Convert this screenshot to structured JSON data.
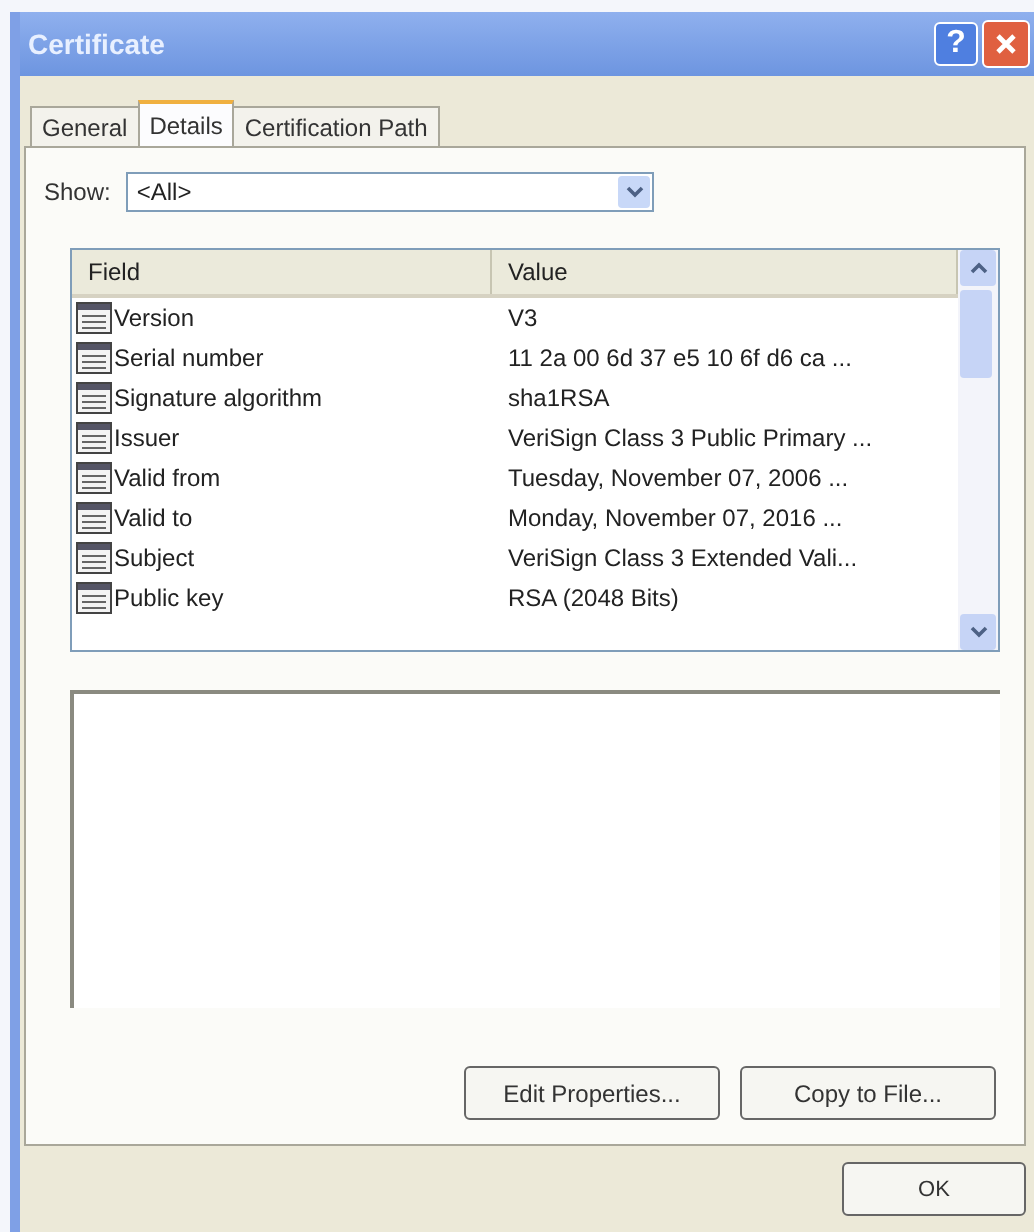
{
  "window": {
    "title": "Certificate",
    "help": "?"
  },
  "tabs": [
    {
      "label": "General",
      "selected": false
    },
    {
      "label": "Details",
      "selected": true
    },
    {
      "label": "Certification Path",
      "selected": false
    }
  ],
  "show": {
    "label": "Show:",
    "value": "<All>"
  },
  "table": {
    "columns": [
      "Field",
      "Value"
    ],
    "rows": [
      {
        "field": "Version",
        "value": "V3"
      },
      {
        "field": "Serial number",
        "value": "11 2a 00 6d 37 e5 10 6f d6 ca ..."
      },
      {
        "field": "Signature algorithm",
        "value": "sha1RSA"
      },
      {
        "field": "Issuer",
        "value": "VeriSign Class 3 Public Primary ..."
      },
      {
        "field": "Valid from",
        "value": "Tuesday, November 07, 2006 ..."
      },
      {
        "field": "Valid to",
        "value": "Monday, November 07, 2016 ..."
      },
      {
        "field": "Subject",
        "value": "VeriSign Class 3 Extended Vali..."
      },
      {
        "field": "Public key",
        "value": "RSA (2048 Bits)"
      }
    ]
  },
  "buttons": [
    "Edit Properties...",
    "Copy to File..."
  ],
  "ok": "OK"
}
